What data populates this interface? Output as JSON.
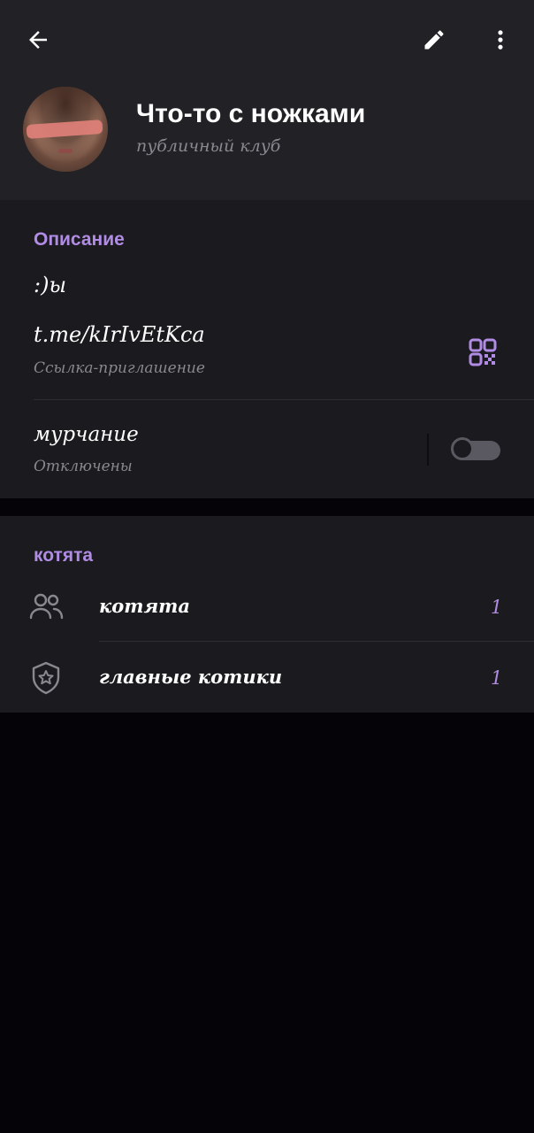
{
  "header": {
    "back_icon": "arrow-left-icon",
    "edit_icon": "pencil-icon",
    "more_icon": "more-vertical-icon",
    "title": "Что-то с ножками",
    "subtitle": "публичный клуб"
  },
  "description": {
    "heading": "Описание",
    "text": ":)ы"
  },
  "invite": {
    "link": "t.me/kIrIvEtKca",
    "label": "Ссылка-приглашение",
    "qr_icon": "qr-code-icon"
  },
  "notifications": {
    "title": "мурчание",
    "status": "Отключены",
    "enabled": false
  },
  "members_section": {
    "heading": "котята",
    "rows": [
      {
        "icon": "people-icon",
        "label": "котята",
        "count": "1"
      },
      {
        "icon": "shield-star-icon",
        "label": "главные котики",
        "count": "1"
      }
    ]
  },
  "colors": {
    "accent": "#b08ce5",
    "header_bg": "#222125",
    "section_bg": "#1b1a1e",
    "page_bg": "#060308"
  }
}
